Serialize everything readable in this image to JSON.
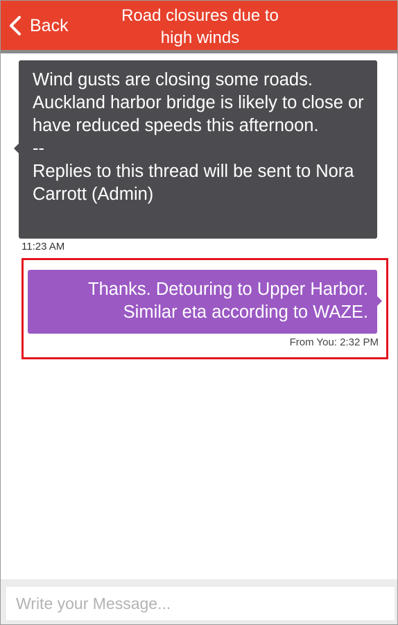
{
  "header": {
    "back_label": "Back",
    "title": "Road closures due to high winds",
    "background_color": "#e7412c"
  },
  "thread": {
    "incoming": {
      "text": "Wind gusts are closing some roads. Auckland harbor bridge is likely to close or have reduced speeds this afternoon.\n--\nReplies to this thread will be sent to Nora Carrott (Admin)",
      "time": "11:23 AM",
      "bubble_color": "#4c4b4f"
    },
    "outgoing": {
      "text": "Thanks. Detouring to Upper Harbor.\nSimilar eta according to WAZE.",
      "time": "From You: 2:32 PM",
      "bubble_color": "#9b59c4",
      "highlight_color": "#e3141f"
    }
  },
  "composer": {
    "placeholder": "Write your Message...",
    "value": ""
  },
  "icons": {
    "back": "chevron-left-icon"
  }
}
